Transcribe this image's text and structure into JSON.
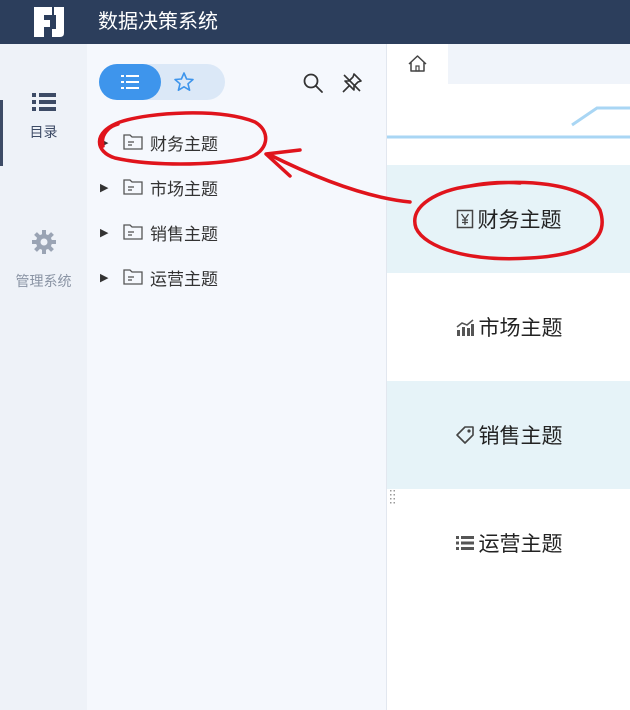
{
  "header": {
    "app_title": "数据决策系统",
    "logo_icon": "app-logo-icon"
  },
  "leftnav": {
    "items": [
      {
        "label": "目录",
        "icon": "list-icon",
        "active": true
      },
      {
        "label": "管理系统",
        "icon": "gear-icon",
        "active": false
      }
    ]
  },
  "tree": {
    "items": [
      {
        "label": "财务主题"
      },
      {
        "label": "市场主题"
      },
      {
        "label": "销售主题"
      },
      {
        "label": "运营主题"
      }
    ]
  },
  "content": {
    "home_tab_icon": "home-icon",
    "cards": [
      {
        "label": "财务主题",
        "icon": "yen-icon",
        "highlighted": true
      },
      {
        "label": "市场主题",
        "icon": "bar-chart-icon",
        "highlighted": false
      },
      {
        "label": "销售主题",
        "icon": "tag-icon",
        "highlighted": true
      },
      {
        "label": "运营主题",
        "icon": "stack-list-icon",
        "highlighted": false
      }
    ]
  },
  "colors": {
    "topbar": "#2c3e5c",
    "accent": "#3e95ec",
    "highlight_row": "#e6f3f8",
    "annotation": "#e0141c"
  }
}
